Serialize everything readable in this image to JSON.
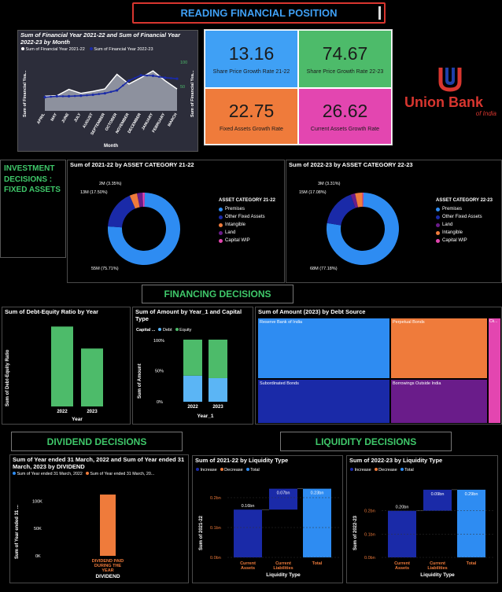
{
  "header": {
    "title": "READING FINANCIAL POSITION"
  },
  "line_chart": {
    "title": "Sum of Financial Year 2021-22 and Sum of Financial Year 2022-23 by Month",
    "legend": [
      "Sum of Financial Year 2021-22",
      "Sum of Financial Year 2022-23"
    ],
    "ylabel_left": "Sum of Financial Yea...",
    "ylabel_right": "Sum of Financial Yea...",
    "xlabel": "Month",
    "right_ticks": [
      "100",
      "50"
    ]
  },
  "kpis": [
    {
      "value": "13.16",
      "label": "Share Price Growth Rate 21-22",
      "color": "#3fa0f5"
    },
    {
      "value": "74.67",
      "label": "Share Price Growth Rate 22-23",
      "color": "#4dbb6a"
    },
    {
      "value": "22.75",
      "label": "Fixed Assets Growth Rate",
      "color": "#ef7b3b"
    },
    {
      "value": "26.62",
      "label": "Current Assets Growth Rate",
      "color": "#e346b0"
    }
  ],
  "logo": {
    "text": "Union Bank",
    "sub": "of India"
  },
  "investment": {
    "title": "INVESTMENT DECISIONS : FIXED ASSETS"
  },
  "donut1": {
    "title": "Sum of 2021-22 by ASSET CATEGORY 21-22",
    "legend_title": "ASSET CATEGORY 21-22",
    "labels": {
      "big": "55M (75.71%)",
      "mid": "13M (17.50%)",
      "small": "2M (3.35%)"
    }
  },
  "donut2": {
    "title": "Sum of 2022-23 by ASSET CATEGORY 22-23",
    "legend_title": "ASSET CATEGORY 22-23",
    "labels": {
      "big": "68M (77.18%)",
      "mid": "15M (17.08%)",
      "small": "3M (3.31%)"
    }
  },
  "financing": {
    "title": "FINANCING DECISIONS"
  },
  "debt_equity": {
    "title": "Sum of Debt-Equity Ratio by Year",
    "ylabel": "Sum of Debt-Equity Ratio",
    "xlabel": "Year"
  },
  "capital": {
    "title": "Sum of Amount by Year_1 and Capital Type",
    "legend_label": "Capital ...",
    "legend": [
      "Debt",
      "Equity"
    ],
    "ylabel": "Sum of Amount",
    "xlabel": "Year_1",
    "ticks": [
      "100%",
      "50%",
      "0%"
    ]
  },
  "treemap": {
    "title": "Sum of Amount (2023) by Debt Source",
    "labels": [
      "Reserve Bank of India",
      "Perpetual Bonds",
      "Ck...",
      "Subordinated Bonds",
      "Borrowings Outside India"
    ]
  },
  "dividend": {
    "title": "DIVIDEND DECISIONS",
    "chart_title": "Sum of Year ended 31 March, 2022 and Sum of Year ended 31 March, 2023 by DIVIDEND",
    "legend": [
      "Sum of Year ended 31 March, 2022",
      "Sum of Year ended 31 March, 20..."
    ],
    "ylabel": "Sum of Year ended 31 ...",
    "xlabel": "DIVIDEND",
    "category": "DIVIDEND PAID DURING THE YEAR",
    "ticks": [
      "100K",
      "50K",
      "0K"
    ]
  },
  "liquidity": {
    "title": "LIQUIDITY DECISIONS"
  },
  "liq1": {
    "title": "Sum of 2021-22 by Liquidity Type",
    "ylabel": "Sum of 2021-22",
    "xlabel": "Liquidity Type",
    "legend": [
      "Increase",
      "Decrease",
      "Total"
    ],
    "ticks": [
      "0.2bn",
      "0.1bn",
      "0.0bn"
    ]
  },
  "liq2": {
    "title": "Sum of 2022-23 by Liquidity Type",
    "ylabel": "Sum of 2022-23",
    "xlabel": "Liquidity Type",
    "legend": [
      "Increase",
      "Decrease",
      "Total"
    ],
    "ticks": [
      "0.2bn",
      "0.1bn",
      "0.0bn"
    ]
  },
  "chart_data": [
    {
      "type": "line",
      "categories": [
        "APRIL",
        "MAY",
        "JUNE",
        "JULY",
        "AUGUST",
        "SEPTEMBER",
        "OCTOBER",
        "NOVEMBER",
        "DECEMBER",
        "JANUARY",
        "FEBRUARY",
        "MARCH"
      ],
      "series": [
        {
          "name": "Sum of Financial Year 2021-22",
          "values": [
            30,
            31,
            44,
            36,
            40,
            45,
            75,
            55,
            68,
            82,
            62,
            45
          ]
        },
        {
          "name": "Sum of Financial Year 2022-23",
          "values": [
            28,
            30,
            30,
            31,
            33,
            36,
            42,
            62,
            73,
            72,
            68,
            66
          ]
        }
      ],
      "right_axis": [
        0,
        100
      ]
    },
    {
      "type": "pie",
      "title": "Sum of 2021-22 by ASSET CATEGORY 21-22",
      "categories": [
        "Premises",
        "Other Fixed Assets",
        "Intangible",
        "Land",
        "Capital WIP"
      ],
      "values": [
        75.71,
        17.5,
        3.35,
        2.5,
        0.94
      ],
      "colors": [
        "#2e8cf2",
        "#1a2aa8",
        "#ef7b3b",
        "#6a1c8a",
        "#e346b0"
      ]
    },
    {
      "type": "pie",
      "title": "Sum of 2022-23 by ASSET CATEGORY 22-23",
      "categories": [
        "Premises",
        "Other Fixed Assets",
        "Land",
        "Intangible",
        "Capital WIP"
      ],
      "values": [
        77.18,
        17.08,
        2.0,
        3.31,
        0.43
      ],
      "colors": [
        "#2e8cf2",
        "#1a2aa8",
        "#6a1c8a",
        "#ef7b3b",
        "#e346b0"
      ]
    },
    {
      "type": "bar",
      "title": "Sum of Debt-Equity Ratio by Year",
      "categories": [
        "2022",
        "2023"
      ],
      "values": [
        0.8,
        0.58
      ],
      "ylim": [
        0,
        0.85
      ]
    },
    {
      "type": "bar",
      "title": "Sum of Amount by Year_1 and Capital Type",
      "categories": [
        "2022",
        "2023"
      ],
      "series": [
        {
          "name": "Debt",
          "values": [
            42,
            38
          ]
        },
        {
          "name": "Equity",
          "values": [
            58,
            62
          ]
        }
      ],
      "ylim": [
        0,
        100
      ]
    },
    {
      "type": "heatmap",
      "title": "Sum of Amount (2023) by Debt Source",
      "categories": [
        "Reserve Bank of India",
        "Perpetual Bonds",
        "Ck...",
        "Subordinated Bonds",
        "Borrowings Outside India"
      ]
    },
    {
      "type": "bar",
      "title": "Sum of Year ended 31 March, 2022 and Sum of Year ended 31 March, 2023 by DIVIDEND",
      "categories": [
        "DIVIDEND PAID DURING THE YEAR"
      ],
      "series": [
        {
          "name": "Sum of Year ended 31 March, 2022",
          "values": [
            0
          ]
        },
        {
          "name": "Sum of Year ended 31 March, 2023",
          "values": [
            112
          ]
        }
      ],
      "ylim": [
        0,
        125
      ]
    },
    {
      "type": "bar",
      "title": "Sum of 2021-22 by Liquidity Type",
      "categories": [
        "Current Assets",
        "Current Liabilities",
        "Total"
      ],
      "values": [
        0.16,
        0.07,
        0.23
      ],
      "data_labels": [
        "0.16bn",
        "0.07bn",
        "0.23bn"
      ],
      "ylim": [
        0,
        0.25
      ]
    },
    {
      "type": "bar",
      "title": "Sum of 2022-23 by Liquidity Type",
      "categories": [
        "Current Assets",
        "Current Liabilities",
        "Total"
      ],
      "values": [
        0.2,
        0.09,
        0.29
      ],
      "data_labels": [
        "0.20bn",
        "0.09bn",
        "0.29bn"
      ],
      "ylim": [
        0,
        0.32
      ]
    }
  ]
}
